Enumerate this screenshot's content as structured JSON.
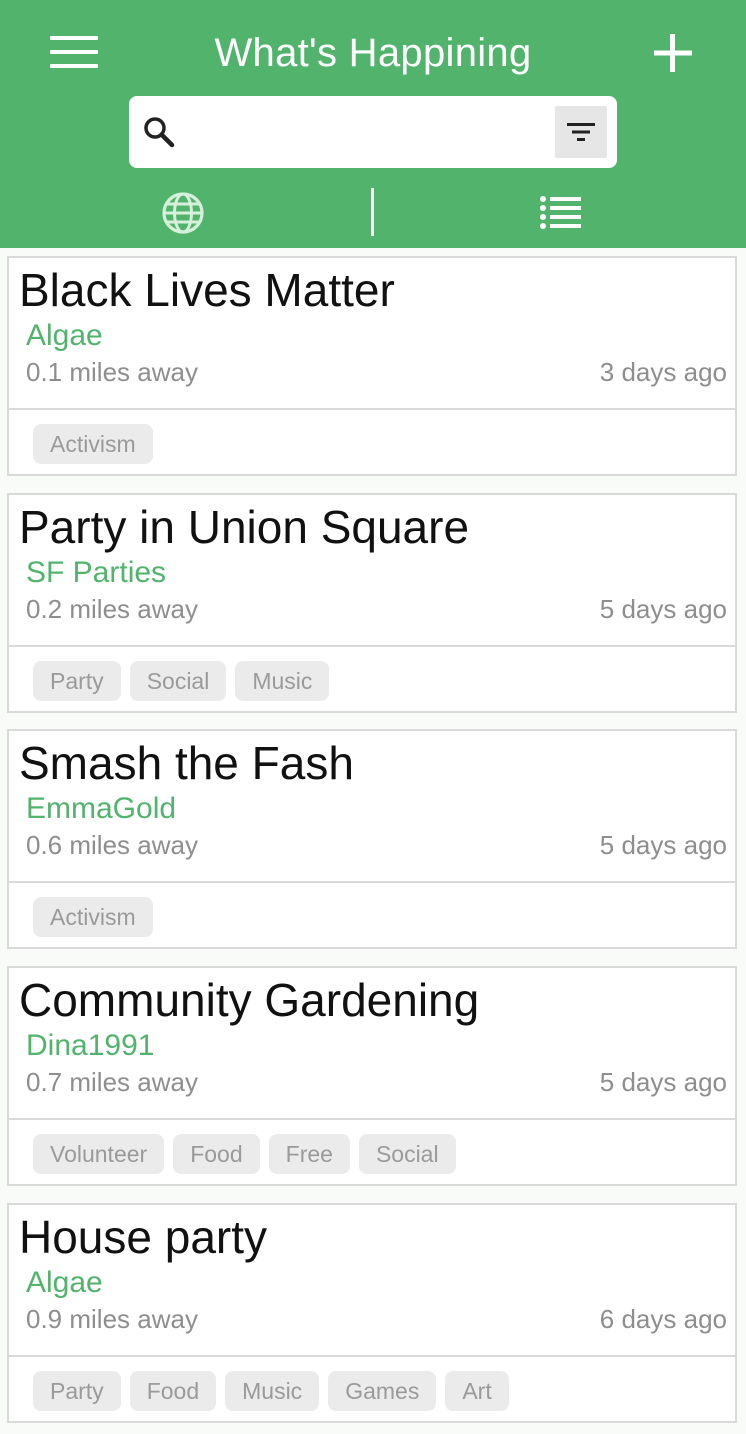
{
  "header": {
    "title": "What's Happining",
    "menu_icon": "hamburger-menu-icon",
    "add_icon": "plus-icon",
    "background_color": "#52b36d"
  },
  "search": {
    "placeholder": "",
    "value": "",
    "search_icon": "search-icon",
    "filter_icon": "filter-icon"
  },
  "view_toggle": {
    "map_icon": "globe-icon",
    "list_icon": "list-icon"
  },
  "colors": {
    "accent": "#52b36d",
    "secondary_text": "#8e8e8e",
    "tag_background": "#ebebeb"
  },
  "events": [
    {
      "title": "Black Lives Matter",
      "organizer": "Algae",
      "distance": "0.1 miles away",
      "time": "3 days ago",
      "tags": [
        "Activism"
      ]
    },
    {
      "title": "Party in Union Square",
      "organizer": "SF Parties",
      "distance": "0.2 miles away",
      "time": "5 days ago",
      "tags": [
        "Party",
        "Social",
        "Music"
      ]
    },
    {
      "title": "Smash the Fash",
      "organizer": "EmmaGold",
      "distance": "0.6 miles away",
      "time": "5 days ago",
      "tags": [
        "Activism"
      ]
    },
    {
      "title": "Community Gardening",
      "organizer": "Dina1991",
      "distance": "0.7 miles away",
      "time": "5 days ago",
      "tags": [
        "Volunteer",
        "Food",
        "Free",
        "Social"
      ]
    },
    {
      "title": "House party",
      "organizer": "Algae",
      "distance": "0.9 miles away",
      "time": "6 days ago",
      "tags": [
        "Party",
        "Food",
        "Music",
        "Games",
        "Art"
      ]
    }
  ]
}
